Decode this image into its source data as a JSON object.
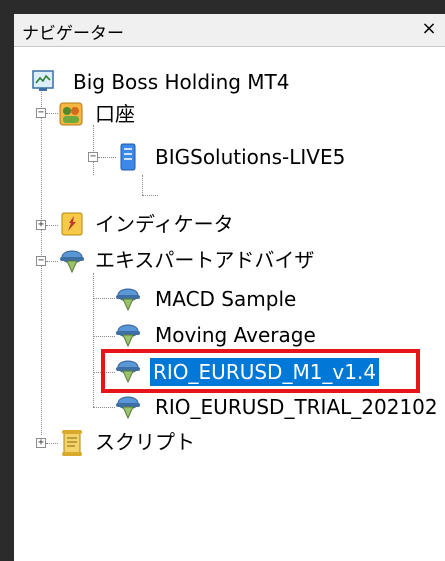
{
  "panel": {
    "title": "ナビゲーター",
    "close_label": "×"
  },
  "tree": {
    "root": {
      "label": "Big Boss Holding MT4",
      "icon": "terminal-icon"
    },
    "accounts": {
      "label": "口座",
      "icon": "accounts-icon",
      "expander": "−"
    },
    "server": {
      "label": "BIGSolutions-LIVE5",
      "icon": "server-icon",
      "expander": "−"
    },
    "indicators": {
      "label": "インディケータ",
      "icon": "indicator-icon",
      "expander": "+"
    },
    "experts": {
      "label": "エキスパートアドバイザ",
      "icon": "expert-advisor-icon",
      "expander": "−"
    },
    "ea_items": [
      {
        "label": "MACD Sample"
      },
      {
        "label": "Moving Average"
      },
      {
        "label": "RIO_EURUSD_M1_v1.4",
        "selected": true
      },
      {
        "label": "RIO_EURUSD_TRIAL_202102"
      }
    ],
    "scripts": {
      "label": "スクリプト",
      "icon": "script-icon",
      "expander": "+"
    }
  },
  "colors": {
    "selection": "#0078d7",
    "highlight_border": "#e8141c"
  }
}
